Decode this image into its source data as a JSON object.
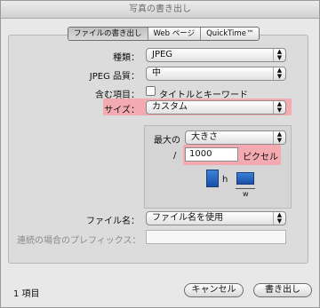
{
  "window": {
    "title": "写真の書き出し"
  },
  "tabs": [
    {
      "label": "ファイルの書き出し"
    },
    {
      "label": "Web ページ"
    },
    {
      "label": "QuickTime™"
    }
  ],
  "form": {
    "kind_label": "種類：",
    "kind_value": "JPEG",
    "quality_label": "JPEG 品質：",
    "quality_value": "中",
    "include_label": "含む項目：",
    "include_checkbox_label": "タイトルとキーワード",
    "size_label": "サイズ：",
    "size_value": "カスタム",
    "max_label": "最大の",
    "max_value": "大きさ",
    "slash": "/",
    "pixel_value": "1000",
    "pixel_unit": "ピクセル",
    "h_label": "h",
    "w_label": "w",
    "filename_label": "ファイル名：",
    "filename_value": "ファイル名を使用",
    "prefix_label": "連続の場合のプレフィックス：",
    "prefix_value": ""
  },
  "footer": {
    "count": "1 項目",
    "cancel_label": "キャンセル",
    "export_label": "書き出し"
  },
  "colors": {
    "highlight": "#f3aab0",
    "doc_blue": "#2b66c2"
  }
}
